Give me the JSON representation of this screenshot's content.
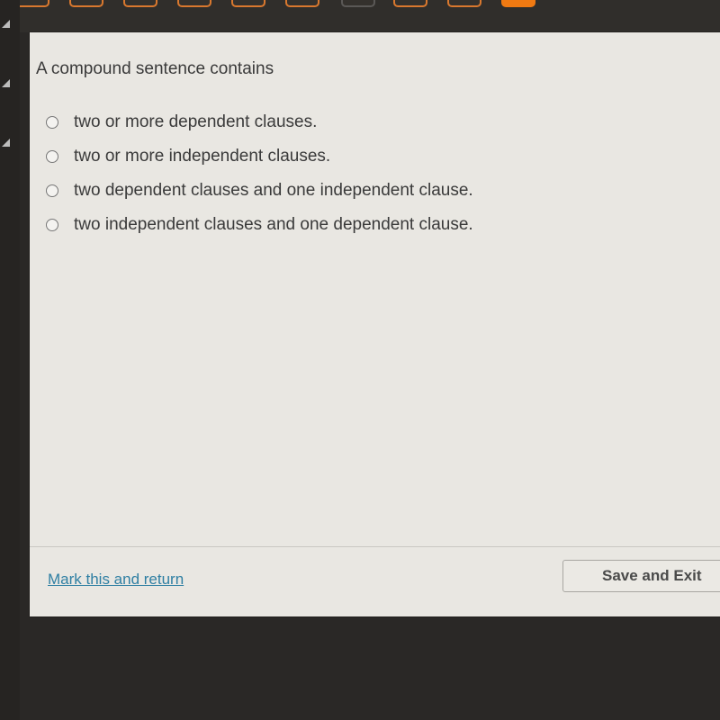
{
  "question_nav": {
    "items": [
      {
        "state": "visited"
      },
      {
        "state": "visited"
      },
      {
        "state": "visited"
      },
      {
        "state": "visited"
      },
      {
        "state": "visited"
      },
      {
        "state": "visited"
      },
      {
        "state": "unvisited"
      },
      {
        "state": "visited"
      },
      {
        "state": "visited"
      },
      {
        "state": "current"
      }
    ],
    "accent_color": "#f07a12"
  },
  "question": {
    "prompt": "A compound sentence contains",
    "options": [
      {
        "label": "two or more dependent clauses.",
        "selected": false
      },
      {
        "label": "two or more independent clauses.",
        "selected": false
      },
      {
        "label": "two dependent clauses and one independent clause.",
        "selected": false
      },
      {
        "label": "two independent clauses and one dependent clause.",
        "selected": false
      }
    ]
  },
  "footer": {
    "mark_link": "Mark this and return",
    "save_exit": "Save and Exit",
    "link_color": "#2f7fa3"
  }
}
